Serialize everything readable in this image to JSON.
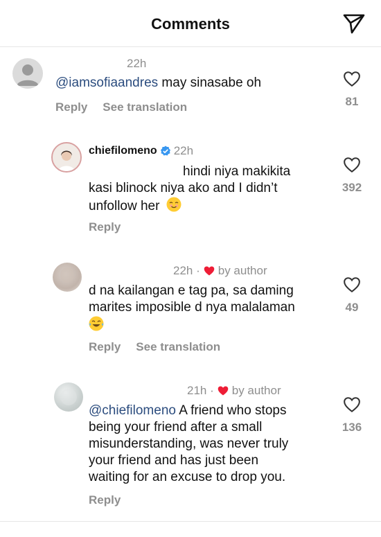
{
  "header": {
    "title": "Comments"
  },
  "comments": [
    {
      "time": "22h",
      "mention": "@iamsofiaandres",
      "text": " may sinasabe oh",
      "reply": "Reply",
      "translate": "See translation",
      "likes": "81"
    },
    {
      "username": "chiefilomeno",
      "time": "22h",
      "line1": "hindi niya makikita",
      "line2": "kasi blinock niya ako and I didn’t",
      "line3": "unfollow her",
      "reply": "Reply",
      "likes": "392"
    },
    {
      "time": "22h ·",
      "by_author": "by author",
      "line1": "d na kailangan e tag pa, sa daming",
      "line2": "marites imposible d nya malalaman",
      "reply": "Reply",
      "translate": "See translation",
      "likes": "49"
    },
    {
      "time": "21h ·",
      "by_author": "by author",
      "mention": "@chiefilomeno",
      "line1": " A friend who stops",
      "line2": "being your friend after a small",
      "line3": "misunderstanding, was never truly",
      "line4": "your friend and has just been",
      "line5": "waiting for an excuse to drop you.",
      "reply": "Reply",
      "likes": "136"
    }
  ]
}
